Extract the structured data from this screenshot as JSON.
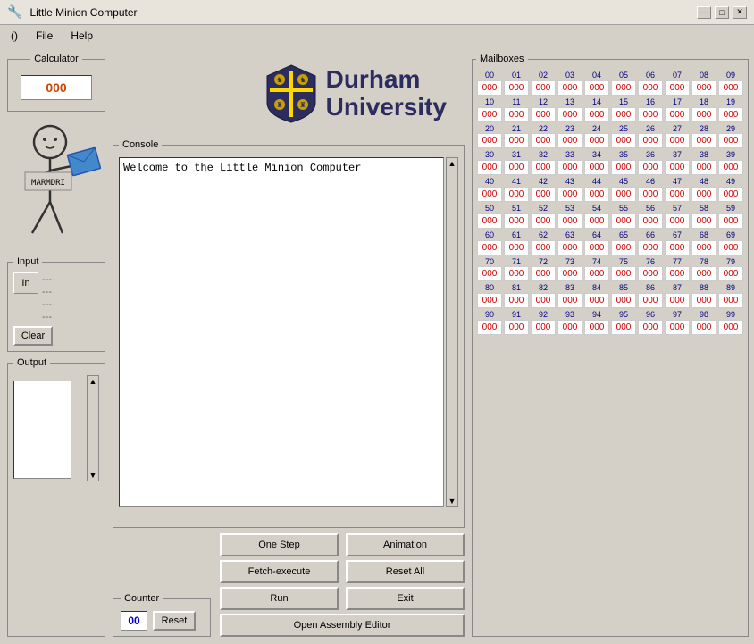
{
  "titlebar": {
    "icon": "🔧",
    "title": "Little Minion Computer",
    "minimize": "─",
    "maximize": "□",
    "close": "✕"
  },
  "menu": {
    "items": [
      "()",
      "File",
      "Help"
    ]
  },
  "calculator": {
    "label": "Calculator",
    "display": "000"
  },
  "input_group": {
    "label": "Input",
    "in_btn": "In",
    "lines": [
      "---",
      "---",
      "---",
      "---"
    ],
    "clear_btn": "Clear"
  },
  "output_group": {
    "label": "Output"
  },
  "durham": {
    "name": "Durham",
    "sub": "University"
  },
  "console": {
    "label": "Console",
    "text": "Welcome to the Little Minion Computer"
  },
  "counter": {
    "label": "Counter",
    "display": "00",
    "reset_btn": "Reset"
  },
  "buttons": {
    "one_step": "One Step",
    "animation": "Animation",
    "fetch_execute": "Fetch-execute",
    "reset_all": "Reset All",
    "run": "Run",
    "exit": "Exit",
    "open_assembly": "Open Assembly Editor"
  },
  "mailboxes": {
    "label": "Mailboxes",
    "rows": [
      [
        "00",
        "01",
        "02",
        "03",
        "04",
        "05",
        "06",
        "07",
        "08",
        "09"
      ],
      [
        "10",
        "11",
        "12",
        "13",
        "14",
        "15",
        "16",
        "17",
        "18",
        "19"
      ],
      [
        "20",
        "21",
        "22",
        "23",
        "24",
        "25",
        "26",
        "27",
        "28",
        "29"
      ],
      [
        "30",
        "31",
        "32",
        "33",
        "34",
        "35",
        "36",
        "37",
        "38",
        "39"
      ],
      [
        "40",
        "41",
        "42",
        "43",
        "44",
        "45",
        "46",
        "47",
        "48",
        "49"
      ],
      [
        "50",
        "51",
        "52",
        "53",
        "54",
        "55",
        "56",
        "57",
        "58",
        "59"
      ],
      [
        "60",
        "61",
        "62",
        "63",
        "64",
        "65",
        "66",
        "67",
        "68",
        "69"
      ],
      [
        "70",
        "71",
        "72",
        "73",
        "74",
        "75",
        "76",
        "77",
        "78",
        "79"
      ],
      [
        "80",
        "81",
        "82",
        "83",
        "84",
        "85",
        "86",
        "87",
        "88",
        "89"
      ],
      [
        "90",
        "91",
        "92",
        "93",
        "94",
        "95",
        "96",
        "97",
        "98",
        "99"
      ]
    ],
    "default_val": "000"
  }
}
